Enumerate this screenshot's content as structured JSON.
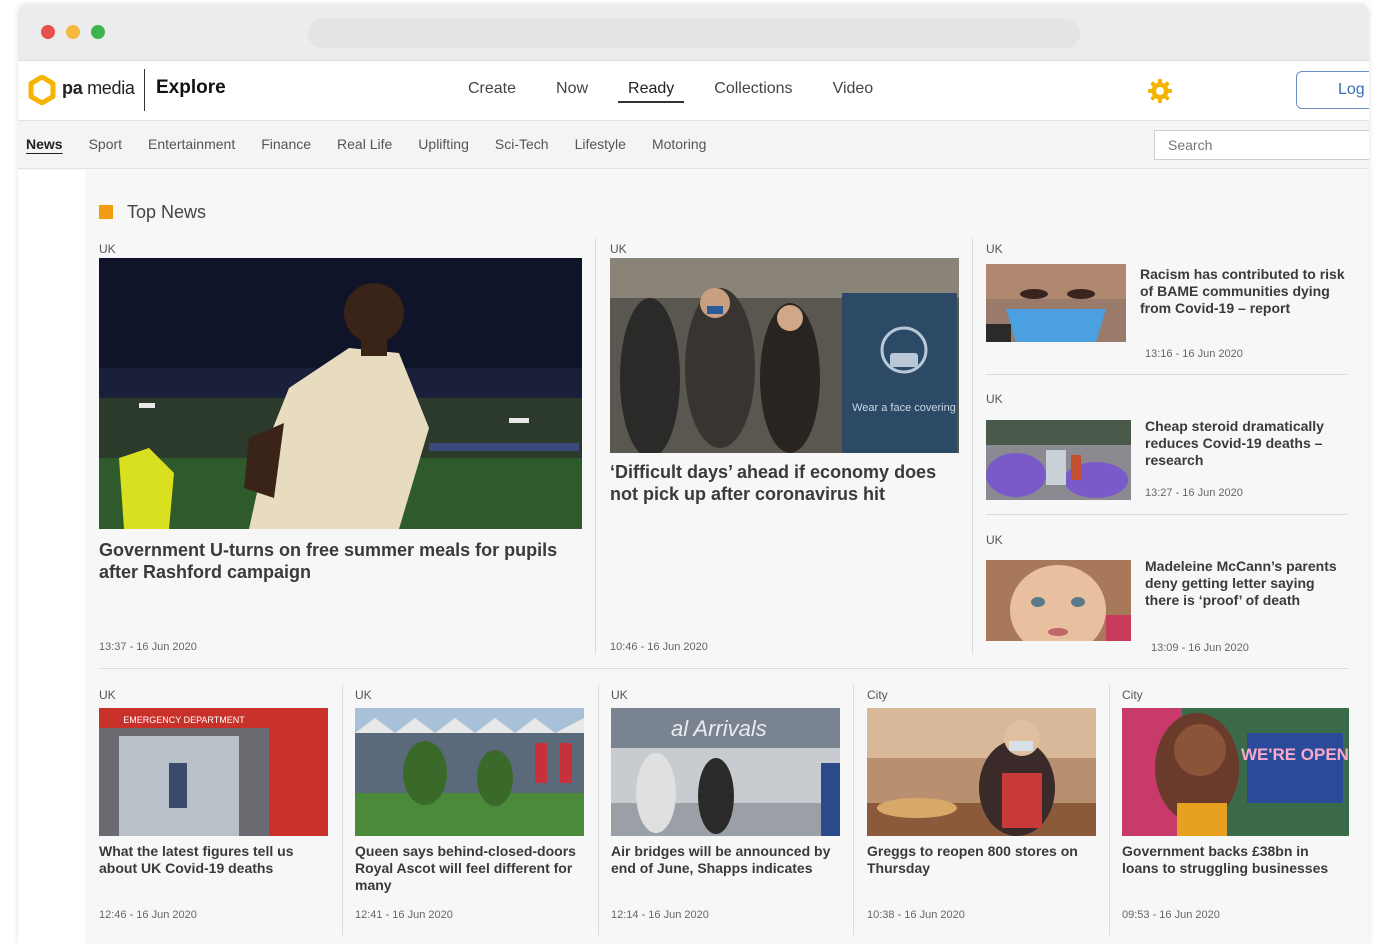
{
  "brand": {
    "logo_light": "pa",
    "logo_rest": "media",
    "product": "Explore"
  },
  "main_nav": [
    {
      "label": "Create"
    },
    {
      "label": "Now"
    },
    {
      "label": "Ready"
    },
    {
      "label": "Collections"
    },
    {
      "label": "Video"
    }
  ],
  "main_nav_active": "Ready",
  "login_label": "Log",
  "categories": [
    {
      "label": "News"
    },
    {
      "label": "Sport"
    },
    {
      "label": "Entertainment"
    },
    {
      "label": "Finance"
    },
    {
      "label": "Real Life"
    },
    {
      "label": "Uplifting"
    },
    {
      "label": "Sci-Tech"
    },
    {
      "label": "Lifestyle"
    },
    {
      "label": "Motoring"
    }
  ],
  "categories_active": "News",
  "search": {
    "placeholder": "Search"
  },
  "section_title": "Top News",
  "accent": "#f39c12",
  "featured": [
    {
      "tag": "UK",
      "headline": "Government U-turns on free summer meals for pupils after Rashford campaign",
      "time": "13:37 - 16 Jun 2020"
    },
    {
      "tag": "UK",
      "headline": "‘Difficult days’ ahead if economy does not pick up after coronavirus hit",
      "time": "10:46 - 16 Jun 2020",
      "image_caption": "Wear a face covering"
    }
  ],
  "side_stories": [
    {
      "tag": "UK",
      "headline": "Racism has contributed to risk of BAME communities dying from Covid-19 – report",
      "time": "13:16 - 16 Jun 2020"
    },
    {
      "tag": "UK",
      "headline": "Cheap steroid dramatically reduces Covid-19 deaths – research",
      "time": "13:27 - 16 Jun 2020"
    },
    {
      "tag": "UK",
      "headline": "Madeleine McCann’s parents deny getting letter saying there is ‘proof’ of death",
      "time": "13:09 - 16 Jun 2020"
    }
  ],
  "bottom_stories": [
    {
      "tag": "UK",
      "headline": "What the latest figures tell us about UK Covid-19 deaths",
      "time": "12:46 - 16 Jun 2020",
      "image_caption": "EMERGENCY DEPARTMENT"
    },
    {
      "tag": "UK",
      "headline": "Queen says behind-closed-doors Royal Ascot will feel different for many",
      "time": "12:41 - 16 Jun 2020"
    },
    {
      "tag": "UK",
      "headline": "Air bridges will be announced by end of June, Shapps indicates",
      "time": "12:14 - 16 Jun 2020",
      "image_caption": "al Arrivals"
    },
    {
      "tag": "City",
      "headline": "Greggs to reopen 800 stores on Thursday",
      "time": "10:38 - 16 Jun 2020"
    },
    {
      "tag": "City",
      "headline": "Government backs £38bn in loans to struggling businesses",
      "time": "09:53 - 16 Jun 2020",
      "image_caption": "WE'RE OPEN"
    }
  ]
}
